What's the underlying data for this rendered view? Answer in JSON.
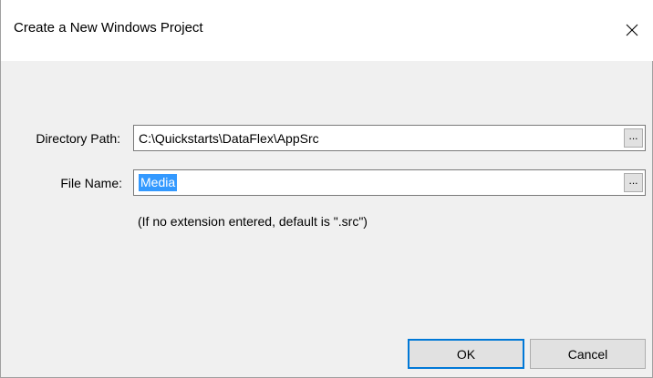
{
  "window": {
    "title": "Create a New Windows Project",
    "close_icon": "close-icon"
  },
  "form": {
    "directory": {
      "label": "Directory Path:",
      "value": "C:\\Quickstarts\\DataFlex\\AppSrc",
      "browse_label": "..."
    },
    "file": {
      "label": "File Name:",
      "value": "Media",
      "browse_label": "..."
    },
    "hint": "(If no extension entered, default is \".src\")"
  },
  "buttons": {
    "ok_label": "OK",
    "cancel_label": "Cancel"
  },
  "colors": {
    "accent": "#0078d7",
    "selection": "#3399ff"
  }
}
